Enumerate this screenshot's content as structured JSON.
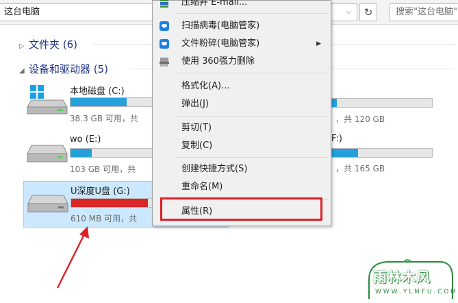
{
  "address_bar": {
    "path": "这台电脑",
    "dropdown_icon": "chevron-down-icon",
    "refresh_icon": "refresh-icon",
    "search_placeholder": "搜索\"这台电脑\""
  },
  "groups": {
    "folders": {
      "label": "文件夹 (6)",
      "collapsed": true
    },
    "devices": {
      "label": "设备和驱动器 (5)",
      "collapsed": false
    }
  },
  "drives": [
    {
      "name": "本地磁盘 (C:)",
      "space_text": "38.3 GB 可用，共",
      "used_fraction": 0.68,
      "color": "#26a0da",
      "icon": "windows-drive-icon"
    },
    {
      "name": "wo (E:)",
      "space_text": "103 GB 可用，共",
      "used_fraction": 0.26,
      "color": "#26a0da",
      "icon": "hard-drive-icon"
    },
    {
      "name": "U深度U盘 (G:)",
      "space_text": "610 MB 可用，共",
      "used_fraction": 0.93,
      "color": "#da2626",
      "icon": "usb-drive-icon",
      "selected": true
    }
  ],
  "right_drives": [
    {
      "space_text": "，共 120 GB",
      "used_fraction": 0.05
    },
    {
      "name_fragment": "F:)",
      "space_text": "，共 165 GB",
      "used_fraction": 0.26
    }
  ],
  "context_menu": {
    "items": [
      {
        "label": "压缩并 E-mail...",
        "icon": "archive-icon"
      },
      {
        "label": "扫描病毒(电脑管家)",
        "icon": "shield-icon"
      },
      {
        "label": "文件粉碎(电脑管家)",
        "icon": "shield-icon",
        "submenu": true
      },
      {
        "label": "使用 360强力删除",
        "icon": "shredder-icon"
      },
      {
        "label": "格式化(A)..."
      },
      {
        "label": "弹出(J)"
      },
      {
        "label": "剪切(T)"
      },
      {
        "label": "复制(C)"
      },
      {
        "label": "创建快捷方式(S)"
      },
      {
        "label": "重命名(M)"
      },
      {
        "label": "属性(R)",
        "highlighted": true
      }
    ],
    "highlight_color": "#dd1f2a"
  },
  "annotation": {
    "arrow_color": "#dd1f2a"
  },
  "watermark": {
    "title": "雨林木风",
    "url": "W W W . Y L M F U . C O M"
  }
}
